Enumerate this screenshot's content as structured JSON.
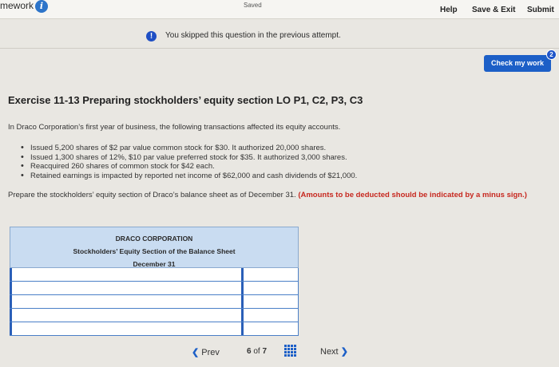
{
  "topbar": {
    "app_title": "mework",
    "saved": "Saved",
    "help": "Help",
    "save_exit": "Save & Exit",
    "submit": "Submit"
  },
  "banner": {
    "text": "You skipped this question in the previous attempt."
  },
  "check": {
    "label": "Check my work",
    "badge": "2"
  },
  "exercise": {
    "title": "Exercise 11-13 Preparing stockholders’ equity section LO P1, C2, P3, C3",
    "intro": "In Draco Corporation’s first year of business, the following transactions affected its equity accounts.",
    "bullets": [
      "Issued 5,200 shares of $2 par value common stock for $30. It authorized 20,000 shares.",
      "Issued 1,300 shares of 12%, $10 par value preferred stock for $35. It authorized 3,000 shares.",
      "Reacquired 260 shares of common stock for $42 each.",
      "Retained earnings is impacted by reported net income of $62,000 and cash dividends of $21,000."
    ],
    "prepare": "Prepare the stockholders’ equity section of Draco’s balance sheet as of December 31.",
    "prepare_note": "(Amounts to be deducted should be indicated by a minus sign.)"
  },
  "table": {
    "company": "DRACO CORPORATION",
    "section": "Stockholders’ Equity Section of the Balance Sheet",
    "date": "December 31",
    "rows": 5
  },
  "nav": {
    "prev": "Prev",
    "page_current": "6",
    "page_of": "of",
    "page_total": "7",
    "next": "Next"
  },
  "colors": {
    "accent": "#1c5fc7",
    "warning_text": "#c7281f",
    "table_header": "#c9dcf1"
  }
}
